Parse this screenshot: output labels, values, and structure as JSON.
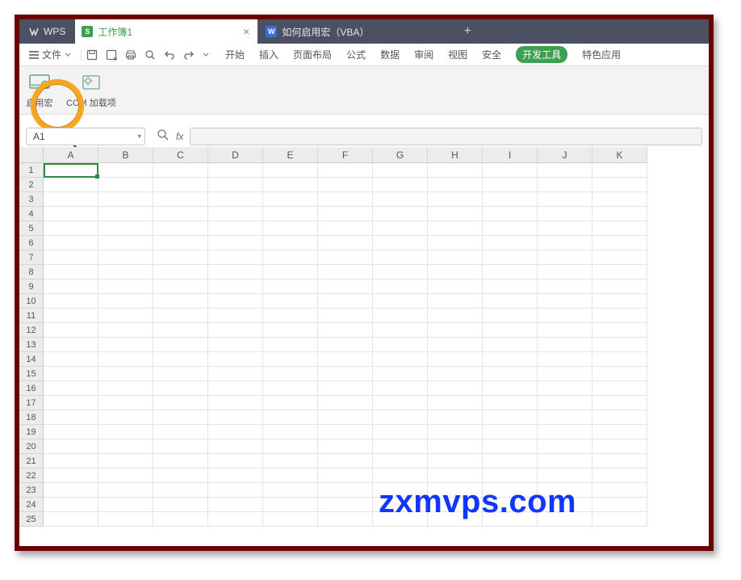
{
  "title": {
    "app": "WPS",
    "doc_tab": "工作簿1",
    "vba_tab": "如何启用宏（VBA）"
  },
  "menu": {
    "file": "文件",
    "tabs": [
      "开始",
      "插入",
      "页面布局",
      "公式",
      "数据",
      "审阅",
      "视图",
      "安全",
      "开发工具",
      "特色应用"
    ],
    "active_tab_index": 8
  },
  "ribbon": {
    "enable_macro": "启用宏",
    "com_addins": "COM 加载项"
  },
  "namebox": {
    "value": "A1",
    "fx_label": "fx"
  },
  "grid": {
    "columns": [
      "A",
      "B",
      "C",
      "D",
      "E",
      "F",
      "G",
      "H",
      "I",
      "J",
      "K"
    ],
    "rows": [
      "1",
      "2",
      "3",
      "4",
      "5",
      "6",
      "7",
      "8",
      "9",
      "10",
      "11",
      "12",
      "13",
      "14",
      "15",
      "16",
      "17",
      "18",
      "19",
      "20",
      "21",
      "22",
      "23",
      "24",
      "25"
    ],
    "selected_cell": "A1"
  },
  "watermark": "zxmvps.com"
}
